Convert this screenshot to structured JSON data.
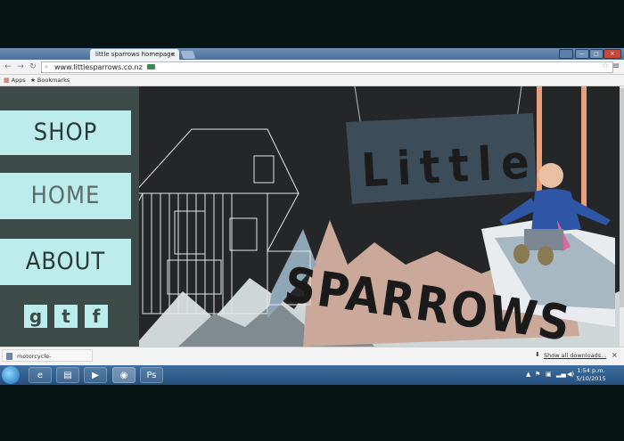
{
  "browser": {
    "tab_title": "little sparrows homepage",
    "tab_close": "×",
    "url": "www.littlesparrows.co.nz",
    "window_controls": [
      "—",
      "□",
      "✕"
    ]
  },
  "bookmarks": {
    "apps_label": "Apps",
    "bookmarks_label": "Bookmarks"
  },
  "site": {
    "nav": {
      "shop": "SHOP",
      "home": "HOME",
      "about": "ABOUT"
    },
    "social": {
      "google": "g",
      "twitter": "t",
      "facebook": "f"
    },
    "sign_top": "Little",
    "sign_bottom": "SPARROWS"
  },
  "downloads": {
    "file_name": "motorcycle-helmets-....jpg",
    "show_all": "Show all downloads...",
    "close": "×"
  },
  "taskbar": {
    "time": "1:54 p.m.",
    "date": "5/10/2015"
  },
  "colors": {
    "accent": "#bdeced",
    "panel": "#3d4b48",
    "page_bg": "#252627"
  }
}
